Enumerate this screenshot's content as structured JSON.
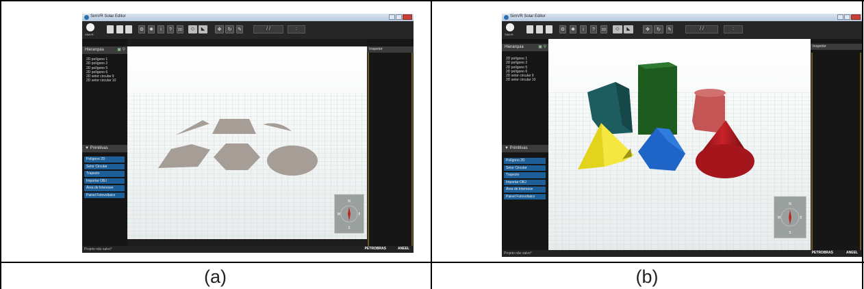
{
  "captions": {
    "a": "(a)",
    "b": "(b)"
  },
  "window": {
    "title": "SimVR Solar Editor",
    "brand_label": "SIMVR",
    "toolbar_3d_label": "3D",
    "date_field": "/ /",
    "time_field": ":"
  },
  "hierarchy": {
    "header": "Hierarquia",
    "items": [
      "2D polígono 1",
      "2D polígono 2",
      "2D polígono 5",
      "2D polígono 6",
      "2D setor circular 9",
      "2D setor circular 10"
    ]
  },
  "primitives": {
    "header": "Primitivas",
    "items": [
      "Polígono 2D",
      "Setor Circular",
      "Trapezio",
      "Importar OBJ",
      "Área de Interesse",
      "Painel Fotovoltaico"
    ]
  },
  "inspector": {
    "header": "Inspetor"
  },
  "status": {
    "text": "Projeto não salvo*",
    "logo_petrobras": "PETROBRAS",
    "logo_aneel": "ANEEL"
  },
  "compass": {
    "n": "N",
    "s": "S",
    "e": "E",
    "w": "W"
  },
  "colors": {
    "shape_2d": "#a79d97",
    "shape_teal": "#1d5c5f",
    "shape_green": "#1d5b1f",
    "shape_pink": "#c35555",
    "shape_yellow": "#e7d81f",
    "shape_blue": "#1f65c8",
    "shape_red": "#a4161b",
    "primitive_button": "#1d5f99"
  }
}
